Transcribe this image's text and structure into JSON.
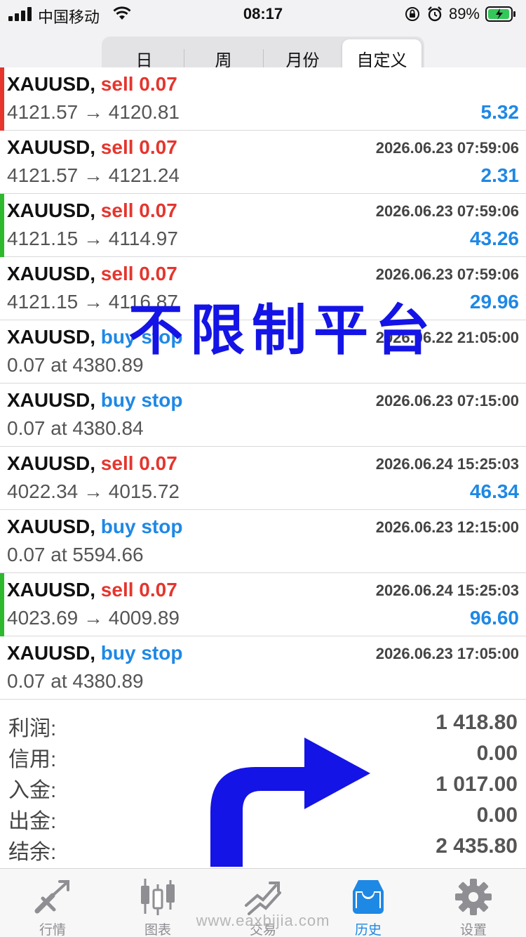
{
  "status_bar": {
    "carrier": "中国移动",
    "time": "08:17",
    "battery": "89%"
  },
  "period_tabs": [
    {
      "label": "日",
      "active": false
    },
    {
      "label": "周",
      "active": false
    },
    {
      "label": "月份",
      "active": false
    },
    {
      "label": "自定义",
      "active": true
    }
  ],
  "deals": [
    {
      "symbol": "XAUUSD,",
      "direction": "sell 0.07",
      "type": "sell",
      "time": "",
      "prices": "4121.57 → 4120.81",
      "profit": "5.32",
      "marker": "#e5352d"
    },
    {
      "symbol": "XAUUSD,",
      "direction": "sell 0.07",
      "type": "sell",
      "time": "2026.06.23 07:59:06",
      "prices": "4121.57 → 4121.24",
      "profit": "2.31",
      "marker": ""
    },
    {
      "symbol": "XAUUSD,",
      "direction": "sell 0.07",
      "type": "sell",
      "time": "2026.06.23 07:59:06",
      "prices": "4121.15 → 4114.97",
      "profit": "43.26",
      "marker": "#2eb82e"
    },
    {
      "symbol": "XAUUSD,",
      "direction": "sell 0.07",
      "type": "sell",
      "time": "2026.06.23 07:59:06",
      "prices": "4121.15 → 4116.87",
      "profit": "29.96",
      "marker": ""
    },
    {
      "symbol": "XAUUSD,",
      "direction": "buy stop",
      "type": "buy",
      "time": "2026.06.22 21:05:00",
      "prices": "0.07 at 4380.89",
      "profit": "",
      "marker": ""
    },
    {
      "symbol": "XAUUSD,",
      "direction": "buy stop",
      "type": "buy",
      "time": "2026.06.23 07:15:00",
      "prices": "0.07 at 4380.84",
      "profit": "",
      "marker": ""
    },
    {
      "symbol": "XAUUSD,",
      "direction": "sell 0.07",
      "type": "sell",
      "time": "2026.06.24 15:25:03",
      "prices": "4022.34 → 4015.72",
      "profit": "46.34",
      "marker": ""
    },
    {
      "symbol": "XAUUSD,",
      "direction": "buy stop",
      "type": "buy",
      "time": "2026.06.23 12:15:00",
      "prices": "0.07 at 5594.66",
      "profit": "",
      "marker": ""
    },
    {
      "symbol": "XAUUSD,",
      "direction": "sell 0.07",
      "type": "sell",
      "time": "2026.06.24 15:25:03",
      "prices": "4023.69 → 4009.89",
      "profit": "96.60",
      "marker": "#2eb82e"
    },
    {
      "symbol": "XAUUSD,",
      "direction": "buy stop",
      "type": "buy",
      "time": "2026.06.23 17:05:00",
      "prices": "0.07 at 4380.89",
      "profit": "",
      "marker": ""
    }
  ],
  "summary": [
    {
      "label": "利润:",
      "value": "1 418.80"
    },
    {
      "label": "信用:",
      "value": "0.00"
    },
    {
      "label": "入金:",
      "value": "1 017.00"
    },
    {
      "label": "出金:",
      "value": "0.00"
    },
    {
      "label": "结余:",
      "value": "2 435.80"
    }
  ],
  "overlay_text": "不限制平台",
  "tabbar": [
    {
      "label": "行情",
      "icon": "quotes-icon",
      "active": false
    },
    {
      "label": "图表",
      "icon": "chart-icon",
      "active": false
    },
    {
      "label": "交易",
      "icon": "trade-icon",
      "active": false
    },
    {
      "label": "历史",
      "icon": "history-icon",
      "active": true
    },
    {
      "label": "设置",
      "icon": "settings-icon",
      "active": false
    }
  ],
  "watermark": "www.eaxbijia.com",
  "colors": {
    "sell": "#e5352d",
    "buy": "#1e88e5",
    "profit": "#1e88e5",
    "active_tab": "#1e88e5",
    "overlay": "#1414e6"
  }
}
